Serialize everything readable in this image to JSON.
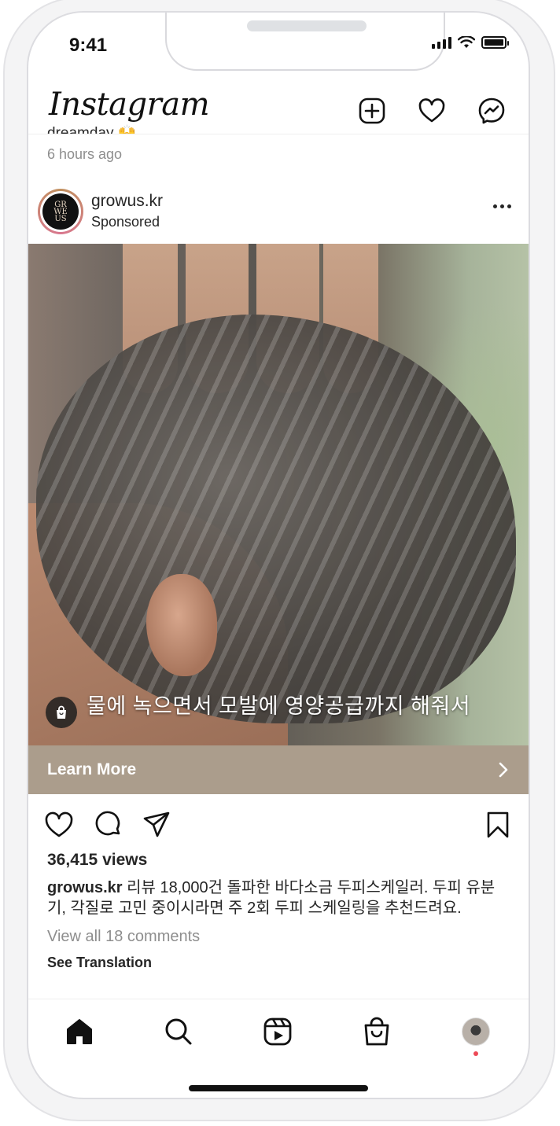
{
  "status_bar": {
    "time": "9:41"
  },
  "header": {
    "logo_text": "Instagram",
    "icons": [
      "new-post-icon",
      "heart-icon",
      "messenger-icon"
    ]
  },
  "previous_post": {
    "caption_fragment": "dreamday 🙌",
    "time_ago": "6 hours ago"
  },
  "post": {
    "username": "growus.kr",
    "subtitle": "Sponsored",
    "video_caption": "물에 녹으면서 모발에 영양공급까지 해줘서",
    "cta_label": "Learn More",
    "cta_color": "#ab9d8c",
    "views": "36,415 views",
    "caption_user": "growus.kr",
    "caption_text": " 리뷰 18,000건 돌파한 바다소금 두피스케일러. 두피 유분기, 각질로 고민 중이시라면 주 2회 두피 스케일링을 추천드려요.",
    "comments_link": "View all 18 comments",
    "see_translation": "See Translation"
  },
  "bottom_nav": {
    "items": [
      "home-icon",
      "search-icon",
      "reels-icon",
      "shop-icon",
      "profile-avatar"
    ]
  },
  "colors": {
    "notification_dot": "#ed4956",
    "muted_text": "#8e8e8e"
  }
}
